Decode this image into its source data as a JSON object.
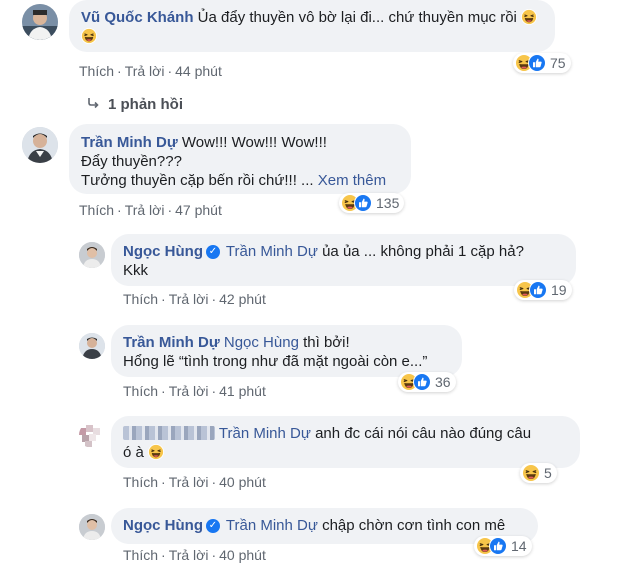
{
  "actions": {
    "like": "Thích",
    "reply": "Trả lời",
    "sep": "·"
  },
  "replies_toggle": {
    "icon": "reply-arrow-icon",
    "label": "1 phản hồi"
  },
  "comments": [
    {
      "author": "Vũ Quốc Khánh",
      "lines": [
        "Ủa đẩy thuyền vô bờ lại đi... chứ thuyền mục rồi"
      ],
      "time": "44 phút",
      "reactions": {
        "icons": [
          "haha-icon",
          "like-icon"
        ],
        "count": "75"
      }
    },
    {
      "author": "Trần Minh Dự",
      "lines": [
        "Wow!!! Wow!!! Wow!!!",
        "Đẩy thuyền???",
        "Tưởng thuyền cặp bến rồi chứ!!! ..."
      ],
      "see_more": "Xem thêm",
      "time": "47 phút",
      "reactions": {
        "icons": [
          "haha-icon",
          "like-icon"
        ],
        "count": "135"
      }
    },
    {
      "author": "Ngọc Hùng",
      "verified": true,
      "tag": "Trần Minh Dự",
      "lines": [
        "ủa ủa ... không phải 1 cặp hả?",
        "Kkk"
      ],
      "time": "42 phút",
      "reactions": {
        "icons": [
          "haha-icon",
          "like-icon"
        ],
        "count": "19"
      }
    },
    {
      "author": "Trần Minh Dự",
      "tag": "Ngọc Hùng",
      "lines": [
        "thì bởi!",
        "Hổng lẽ “tình trong như đã mặt ngoài còn e...”"
      ],
      "time": "41 phút",
      "reactions": {
        "icons": [
          "haha-icon",
          "like-icon"
        ],
        "count": "36"
      }
    },
    {
      "author_redacted": true,
      "tag": "Trần Minh Dự",
      "lines": [
        "anh đc cái nói câu nào đúng câu",
        "ó à"
      ],
      "time": "40 phút",
      "reactions": {
        "icons": [
          "haha-icon"
        ],
        "count": "5"
      }
    },
    {
      "author": "Ngọc Hùng",
      "verified": true,
      "tag": "Trần Minh Dự",
      "lines": [
        "chập chờn cơn tình con mê"
      ],
      "time": "40 phút",
      "reactions": {
        "icons": [
          "haha-icon",
          "like-icon"
        ],
        "count": "14"
      }
    }
  ],
  "colors": {
    "link": "#385898",
    "bubble": "#f0f2f5",
    "meta": "#606770",
    "like_blue": "#1877f2",
    "haha_yellow": "#f7c54a"
  }
}
